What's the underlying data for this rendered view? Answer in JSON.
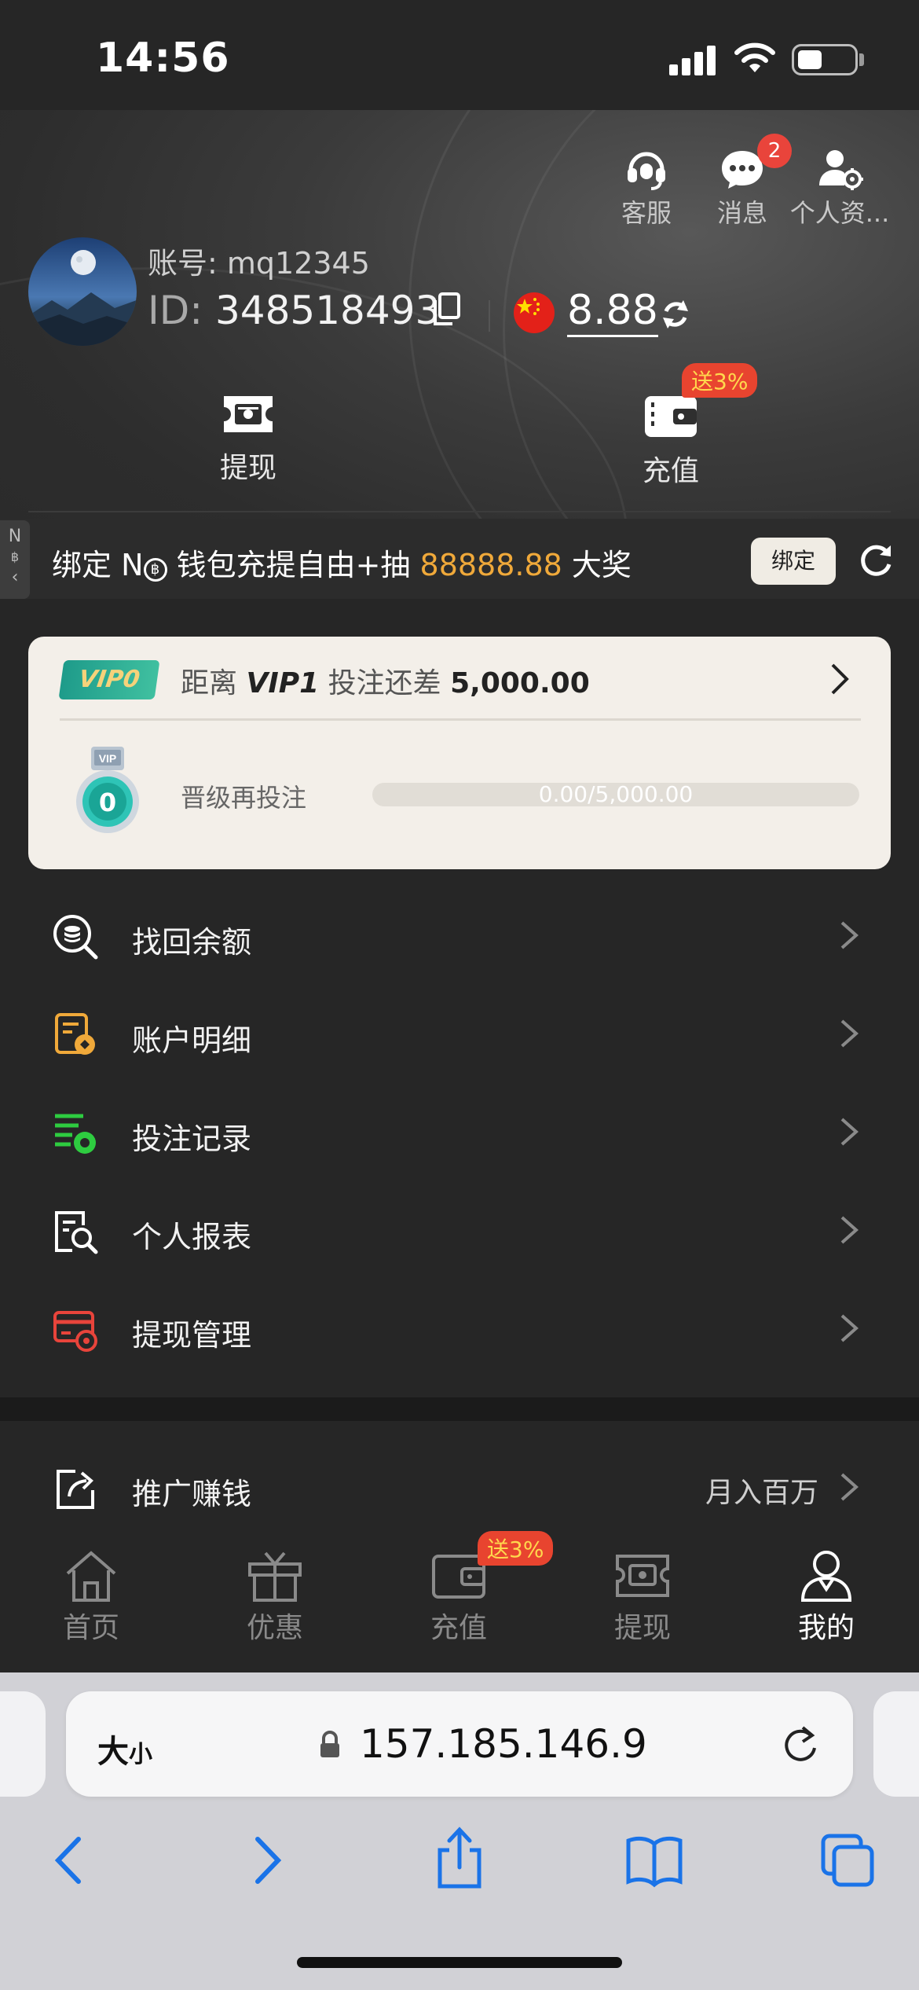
{
  "status_bar": {
    "time": "14:56"
  },
  "header": {
    "top_icons": [
      {
        "label": "客服",
        "icon": "headset-icon"
      },
      {
        "label": "消息",
        "icon": "chat-bubble-icon",
        "badge": "2"
      },
      {
        "label": "个人资...",
        "icon": "user-settings-icon"
      }
    ],
    "account_label": "账号: mq12345",
    "id_prefix": "ID: ",
    "id_value": "348518493",
    "balance": "8.88",
    "actions": [
      {
        "label": "提现",
        "icon": "withdraw-ticket-icon"
      },
      {
        "label": "充值",
        "icon": "wallet-icon",
        "promo": "送3%"
      }
    ]
  },
  "bind_bar": {
    "text_prefix": "绑定 N",
    "text_mid": " 钱包充提自由+抽 ",
    "amount": "88888.88",
    "text_suffix": " 大奖",
    "button": "绑定",
    "side_tab": "N"
  },
  "vip_card": {
    "badge": "VIP0",
    "distance_label": "距离",
    "next_level": "VIP1",
    "bet_label": "投注还差",
    "remaining": "5,000.00",
    "medal_level": "0",
    "upgrade_label": "晋级再投注",
    "progress_text": "0.00/5,000.00",
    "progress_fraction": 0
  },
  "menu": [
    {
      "label": "找回余额",
      "icon": "search-coins-icon",
      "color": "#ffffff"
    },
    {
      "label": "账户明细",
      "icon": "account-detail-icon",
      "color": "#f0a93a"
    },
    {
      "label": "投注记录",
      "icon": "bet-record-icon",
      "color": "#2ecc40"
    },
    {
      "label": "个人报表",
      "icon": "report-search-icon",
      "color": "#ffffff"
    },
    {
      "label": "提现管理",
      "icon": "withdraw-manage-icon",
      "color": "#e8443b"
    }
  ],
  "promo_item": {
    "label": "推广赚钱",
    "right": "月入百万",
    "icon": "share-icon"
  },
  "tabbar": [
    {
      "label": "首页",
      "icon": "home-icon"
    },
    {
      "label": "优惠",
      "icon": "gift-icon"
    },
    {
      "label": "充值",
      "icon": "wallet-icon",
      "promo": "送3%"
    },
    {
      "label": "提现",
      "icon": "withdraw-ticket-icon"
    },
    {
      "label": "我的",
      "icon": "user-icon",
      "active": true
    }
  ],
  "browser": {
    "text_size": "大",
    "text_size_small": "小",
    "url": "157.185.146.9"
  }
}
